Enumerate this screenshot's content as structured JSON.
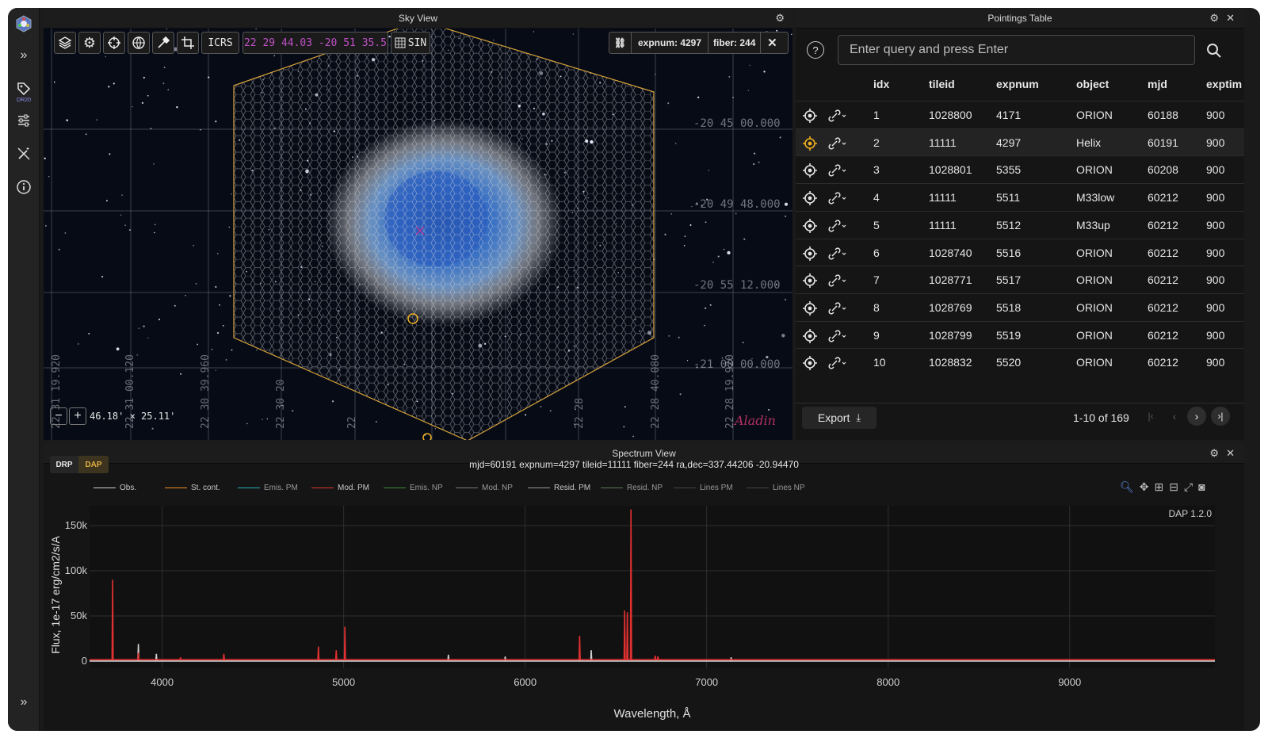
{
  "sidebar": {
    "dr_label": "DR20"
  },
  "sky": {
    "title": "Sky View",
    "frame": "ICRS",
    "coords": "22 29 44.03 -20 51 35.5",
    "projection": "SIN",
    "expnum_label": "expnum: 4297",
    "fiber_label": "fiber: 244",
    "fov": "46.18' × 25.11'",
    "logo": "Aladin",
    "dec_labels": [
      "-20 45 00.000",
      "-20 49 48.000",
      "-20 55 12.000",
      "-21 00 00.000"
    ],
    "ra_labels": [
      "22 31 19.920",
      "22 31 00.120",
      "22 30 39.960",
      "22 30 20",
      "22",
      "22 28",
      "22 28 40.080",
      "22 28 19.920"
    ]
  },
  "table": {
    "title": "Pointings Table",
    "query_placeholder": "Enter query and press Enter",
    "columns": [
      "idx",
      "tileid",
      "expnum",
      "object",
      "mjd",
      "exptim"
    ],
    "rows": [
      {
        "idx": "1",
        "tileid": "1028800",
        "expnum": "4171",
        "object": "ORION",
        "mjd": "60188",
        "exptime": "900"
      },
      {
        "idx": "2",
        "tileid": "11111",
        "expnum": "4297",
        "object": "Helix",
        "mjd": "60191",
        "exptime": "900"
      },
      {
        "idx": "3",
        "tileid": "1028801",
        "expnum": "5355",
        "object": "ORION",
        "mjd": "60208",
        "exptime": "900"
      },
      {
        "idx": "4",
        "tileid": "11111",
        "expnum": "5511",
        "object": "M33low",
        "mjd": "60212",
        "exptime": "900"
      },
      {
        "idx": "5",
        "tileid": "11111",
        "expnum": "5512",
        "object": "M33up",
        "mjd": "60212",
        "exptime": "900"
      },
      {
        "idx": "6",
        "tileid": "1028740",
        "expnum": "5516",
        "object": "ORION",
        "mjd": "60212",
        "exptime": "900"
      },
      {
        "idx": "7",
        "tileid": "1028771",
        "expnum": "5517",
        "object": "ORION",
        "mjd": "60212",
        "exptime": "900"
      },
      {
        "idx": "8",
        "tileid": "1028769",
        "expnum": "5518",
        "object": "ORION",
        "mjd": "60212",
        "exptime": "900"
      },
      {
        "idx": "9",
        "tileid": "1028799",
        "expnum": "5519",
        "object": "ORION",
        "mjd": "60212",
        "exptime": "900"
      },
      {
        "idx": "10",
        "tileid": "1028832",
        "expnum": "5520",
        "object": "ORION",
        "mjd": "60212",
        "exptime": "900"
      }
    ],
    "export_label": "Export",
    "pagination": "1-10 of 169"
  },
  "spectrum": {
    "title": "Spectrum View",
    "tabs": [
      "DRP",
      "DAP"
    ],
    "active_tab": "DAP",
    "info": "mjd=60191 expnum=4297 tileid=11111 fiber=244 ra,dec=337.44206 -20.94470",
    "version": "DAP 1.2.0",
    "legend": [
      {
        "name": "Obs.",
        "color": "#d0d0d0"
      },
      {
        "name": "St. cont.",
        "color": "#f08c2a"
      },
      {
        "name": "Emis. PM",
        "color": "#2aa8b8"
      },
      {
        "name": "Mod. PM",
        "color": "#e03030"
      },
      {
        "name": "Emis. NP",
        "color": "#3a8a3a"
      },
      {
        "name": "Mod. NP",
        "color": "#7a7a7a"
      },
      {
        "name": "Resid. PM",
        "color": "#9a9a9a"
      },
      {
        "name": "Resid. NP",
        "color": "#5a7a5a"
      },
      {
        "name": "Lines PM",
        "color": "#444444"
      },
      {
        "name": "Lines NP",
        "color": "#444444"
      }
    ]
  },
  "chart_data": {
    "type": "line",
    "xlabel": "Wavelength, Å",
    "ylabel": "Flux, 1e-17 erg/cm2/s/A",
    "xlim": [
      3600,
      9800
    ],
    "ylim": [
      -8000,
      172000
    ],
    "x_ticks": [
      4000,
      5000,
      6000,
      7000,
      8000,
      9000
    ],
    "y_ticks": [
      {
        "v": 0,
        "label": "0"
      },
      {
        "v": 50000,
        "label": "50k"
      },
      {
        "v": 100000,
        "label": "100k"
      },
      {
        "v": 150000,
        "label": "150k"
      }
    ],
    "grid": true,
    "series": [
      {
        "name": "Mod. PM",
        "color": "#e03030",
        "baseline": 1500,
        "peaks": [
          [
            3727,
            90000
          ],
          [
            3869,
            9000
          ],
          [
            4101,
            4000
          ],
          [
            4340,
            8000
          ],
          [
            4861,
            16000
          ],
          [
            4959,
            12000
          ],
          [
            5007,
            38000
          ],
          [
            6300,
            28000
          ],
          [
            6548,
            56000
          ],
          [
            6563,
            54000
          ],
          [
            6583,
            168000
          ],
          [
            6716,
            6000
          ],
          [
            6731,
            5000
          ]
        ]
      },
      {
        "name": "Obs.",
        "color": "#d0d0d0",
        "baseline": 0,
        "peaks": [
          [
            3869,
            19000
          ],
          [
            3968,
            8000
          ],
          [
            5577,
            7000
          ],
          [
            5890,
            5000
          ],
          [
            6300,
            9000
          ],
          [
            6364,
            12000
          ],
          [
            7135,
            4000
          ]
        ]
      }
    ]
  }
}
